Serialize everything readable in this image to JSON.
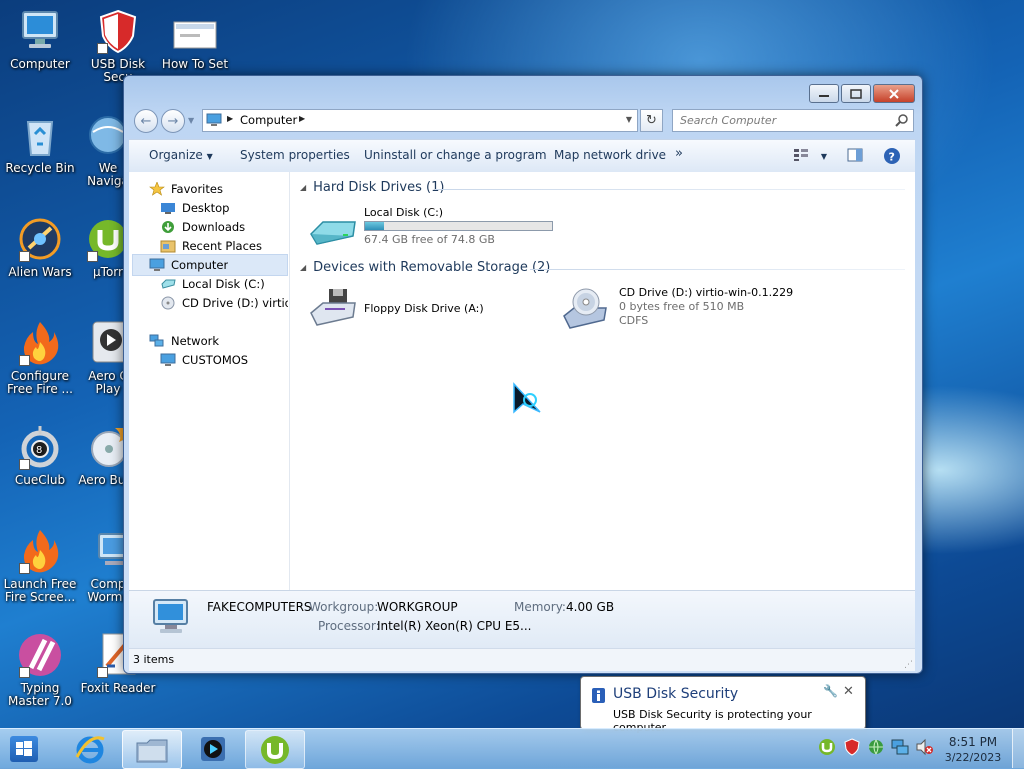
{
  "desktop": {
    "icons": [
      {
        "label": "Computer",
        "icon": "computer-icon"
      },
      {
        "label": "USB Disk Secu",
        "icon": "usb-disk-security-icon"
      },
      {
        "label": "How To Set",
        "icon": "document-icon"
      },
      {
        "label": "Recycle Bin",
        "icon": "recycle-bin-icon"
      },
      {
        "label": "We Naviga",
        "icon": "web-navigator-icon"
      },
      {
        "label": "Alien Wars",
        "icon": "alien-wars-icon"
      },
      {
        "label": "µTorr",
        "icon": "utorrent-icon"
      },
      {
        "label": "Configure Free Fire ...",
        "icon": "fire-icon"
      },
      {
        "label": "Aero C Play",
        "icon": "aero-player-icon"
      },
      {
        "label": "CueClub",
        "icon": "cueclub-icon"
      },
      {
        "label": "Aero Burn",
        "icon": "aero-burn-icon"
      },
      {
        "label": "Launch Free Fire Scree...",
        "icon": "fire-icon"
      },
      {
        "label": "Comp Worms",
        "icon": "computer-worms-icon"
      },
      {
        "label": "Typing Master 7.0",
        "icon": "typing-master-icon"
      },
      {
        "label": "Foxit Reader",
        "icon": "foxit-reader-icon"
      }
    ]
  },
  "explorer": {
    "address": {
      "crumb": "Computer",
      "search_placeholder": "Search Computer"
    },
    "toolbar": {
      "organize": "Organize",
      "system_properties": "System properties",
      "uninstall": "Uninstall or change a program",
      "map_drive": "Map network drive",
      "more": "»"
    },
    "nav": {
      "favorites": "Favorites",
      "desktop": "Desktop",
      "downloads": "Downloads",
      "recent": "Recent Places",
      "computer": "Computer",
      "local_disk": "Local Disk (C:)",
      "cd_drive": "CD Drive (D:) virtio-w",
      "network": "Network",
      "customos": "CUSTOMOS"
    },
    "groups": {
      "hdd": "Hard Disk Drives (1)",
      "removable": "Devices with Removable Storage (2)"
    },
    "drives": {
      "c_name": "Local Disk (C:)",
      "c_free": "67.4 GB free of 74.8 GB",
      "c_used_fraction": 0.099,
      "floppy_name": "Floppy Disk Drive (A:)",
      "cd_name": "CD Drive (D:) virtio-win-0.1.229",
      "cd_free": "0 bytes free of 510 MB",
      "cd_fs": "CDFS"
    },
    "details": {
      "computer_name": "FAKECOMPUTERS",
      "workgroup_label": "Workgroup:",
      "workgroup_value": "WORKGROUP",
      "memory_label": "Memory:",
      "memory_value": "4.00 GB",
      "processor_label": "Processor:",
      "processor_value": "Intel(R) Xeon(R) CPU E5..."
    },
    "status": "3 items"
  },
  "notification": {
    "title": "USB Disk Security",
    "message": "USB Disk Security is protecting your computer"
  },
  "taskbar": {
    "time": "8:51 PM",
    "date": "3/22/2023"
  },
  "colors": {
    "accent": "#2f8fb8",
    "link_blue": "#1e395b"
  }
}
